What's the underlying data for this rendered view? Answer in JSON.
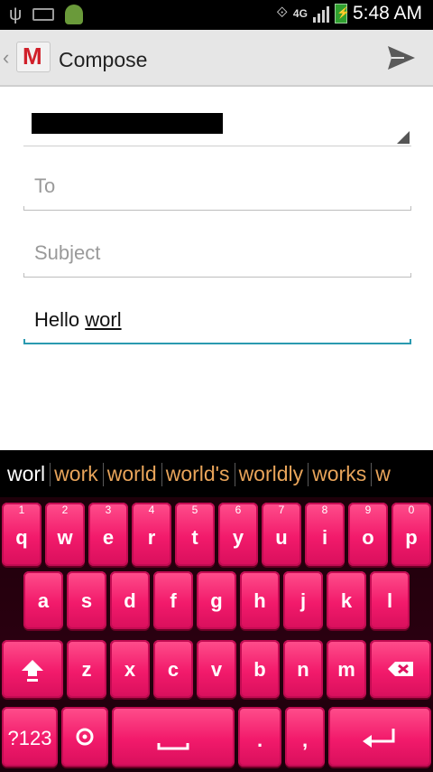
{
  "statusbar": {
    "network": "4G",
    "time": "5:48 AM"
  },
  "actionbar": {
    "title": "Compose"
  },
  "compose": {
    "to_placeholder": "To",
    "subject_placeholder": "Subject",
    "body_prefix": "Hello ",
    "body_composing": "worl"
  },
  "keyboard": {
    "suggestions": [
      "worl",
      "work",
      "world",
      "world's",
      "worldly",
      "works",
      "w"
    ],
    "row1": [
      {
        "num": "1",
        "key": "q"
      },
      {
        "num": "2",
        "key": "w"
      },
      {
        "num": "3",
        "key": "e"
      },
      {
        "num": "4",
        "key": "r"
      },
      {
        "num": "5",
        "key": "t"
      },
      {
        "num": "6",
        "key": "y"
      },
      {
        "num": "7",
        "key": "u"
      },
      {
        "num": "8",
        "key": "i"
      },
      {
        "num": "9",
        "key": "o"
      },
      {
        "num": "0",
        "key": "p"
      }
    ],
    "row2": [
      "a",
      "s",
      "d",
      "f",
      "g",
      "h",
      "j",
      "k",
      "l"
    ],
    "row3": [
      "z",
      "x",
      "c",
      "v",
      "b",
      "n",
      "m"
    ],
    "symbols_label": "?123",
    "period": ".",
    "comma": ","
  },
  "colors": {
    "key_pink": "#f21a6b",
    "suggestion_orange": "#e8a45a",
    "focus_teal": "#2a9ab0"
  }
}
